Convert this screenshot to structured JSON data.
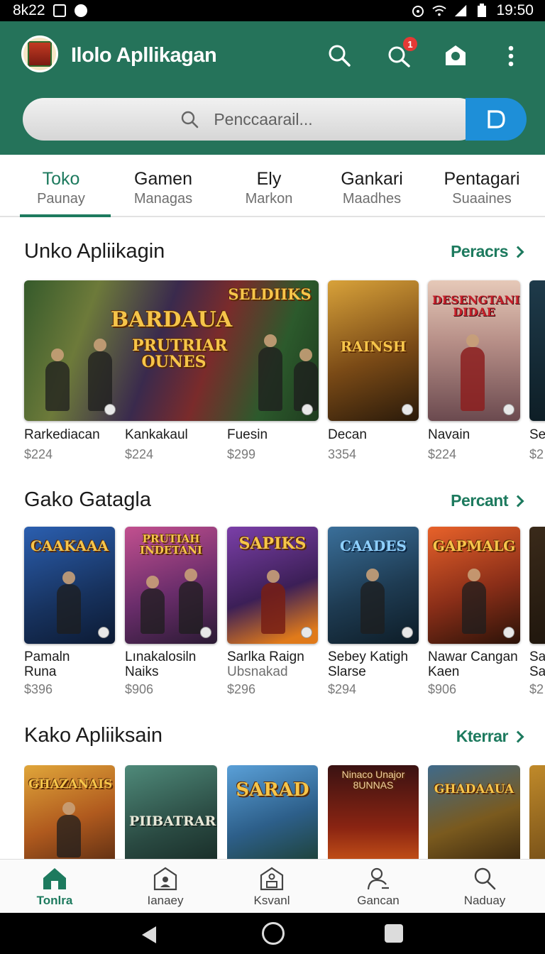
{
  "status_bar": {
    "left_text": "8k22",
    "time": "19:50"
  },
  "header": {
    "title": "Ilolo Apllikagan",
    "notification_count": "1"
  },
  "search": {
    "placeholder": "Penccaarail..."
  },
  "tabs": [
    {
      "title": "Toko",
      "sub": "Paunay"
    },
    {
      "title": "Gamen",
      "sub": "Managas"
    },
    {
      "title": "Ely",
      "sub": "Markon"
    },
    {
      "title": "Gankari",
      "sub": "Maadhes"
    },
    {
      "title": "Pentagari",
      "sub": "Suaaines"
    }
  ],
  "sections": [
    {
      "title": "Unko Apliikagin",
      "more": "Peracrs",
      "items": [
        {
          "thumb_text": "BARDAUA",
          "name": "Rarkediacan",
          "price": "$224"
        },
        {
          "thumb_text": "PRUTRIAR OUNES",
          "name": "Kankakaul",
          "price": "$224"
        },
        {
          "thumb_text": "SELDIIKS",
          "name": "Fuesin",
          "price": "$299"
        },
        {
          "thumb_text": "RAINSH",
          "name": "Decan",
          "price": "3354"
        },
        {
          "thumb_text": "DESENGTANI DIDAE",
          "name": "Navain",
          "price": "$224"
        },
        {
          "thumb_text": "",
          "name": "Se",
          "price": "$2"
        }
      ]
    },
    {
      "title": "Gako Gatagla",
      "more": "Percant",
      "items": [
        {
          "thumb_text": "CAAKAAA",
          "name": "Pamaln",
          "sub": "Runa",
          "price": "$396"
        },
        {
          "thumb_text": "PRUTIAH INDETANI",
          "name": "Lınakalosiln",
          "sub": "Naiks",
          "price": "$906"
        },
        {
          "thumb_text": "SAPIKS",
          "name": "Sarlka Raign",
          "sub": "Ubsnakad",
          "price": "$296"
        },
        {
          "thumb_text": "CAADES",
          "name": "Sebey Katigh",
          "sub": "Slarse",
          "price": "$294"
        },
        {
          "thumb_text": "GAPMALG",
          "name": "Nawar Cangan",
          "sub": "Kaen",
          "price": "$906"
        },
        {
          "thumb_text": "",
          "name": "Sa",
          "sub": "Sa",
          "price": "$2"
        }
      ]
    },
    {
      "title": "Kako Apliiksain",
      "more": "Kterrar",
      "items": [
        {
          "thumb_text": "GHAZANAIS"
        },
        {
          "thumb_text": "PIIBATRAR"
        },
        {
          "thumb_text": "SARAD"
        },
        {
          "thumb_text": "Ninaco Unajor 8UNNAS"
        },
        {
          "thumb_text": "GHADAAUA"
        },
        {
          "thumb_text": ""
        }
      ]
    }
  ],
  "bottom_nav": [
    {
      "label": "Tonlra",
      "icon": "home-icon"
    },
    {
      "label": "Ianaey",
      "icon": "profile-icon"
    },
    {
      "label": "Ksvanl",
      "icon": "store-icon"
    },
    {
      "label": "Gancan",
      "icon": "user-icon"
    },
    {
      "label": "Naduay",
      "icon": "search-icon"
    }
  ],
  "colors": {
    "header_bg": "#25735a",
    "accent": "#1d7a5e",
    "search_button": "#1e8fd8",
    "badge": "#e53935"
  }
}
